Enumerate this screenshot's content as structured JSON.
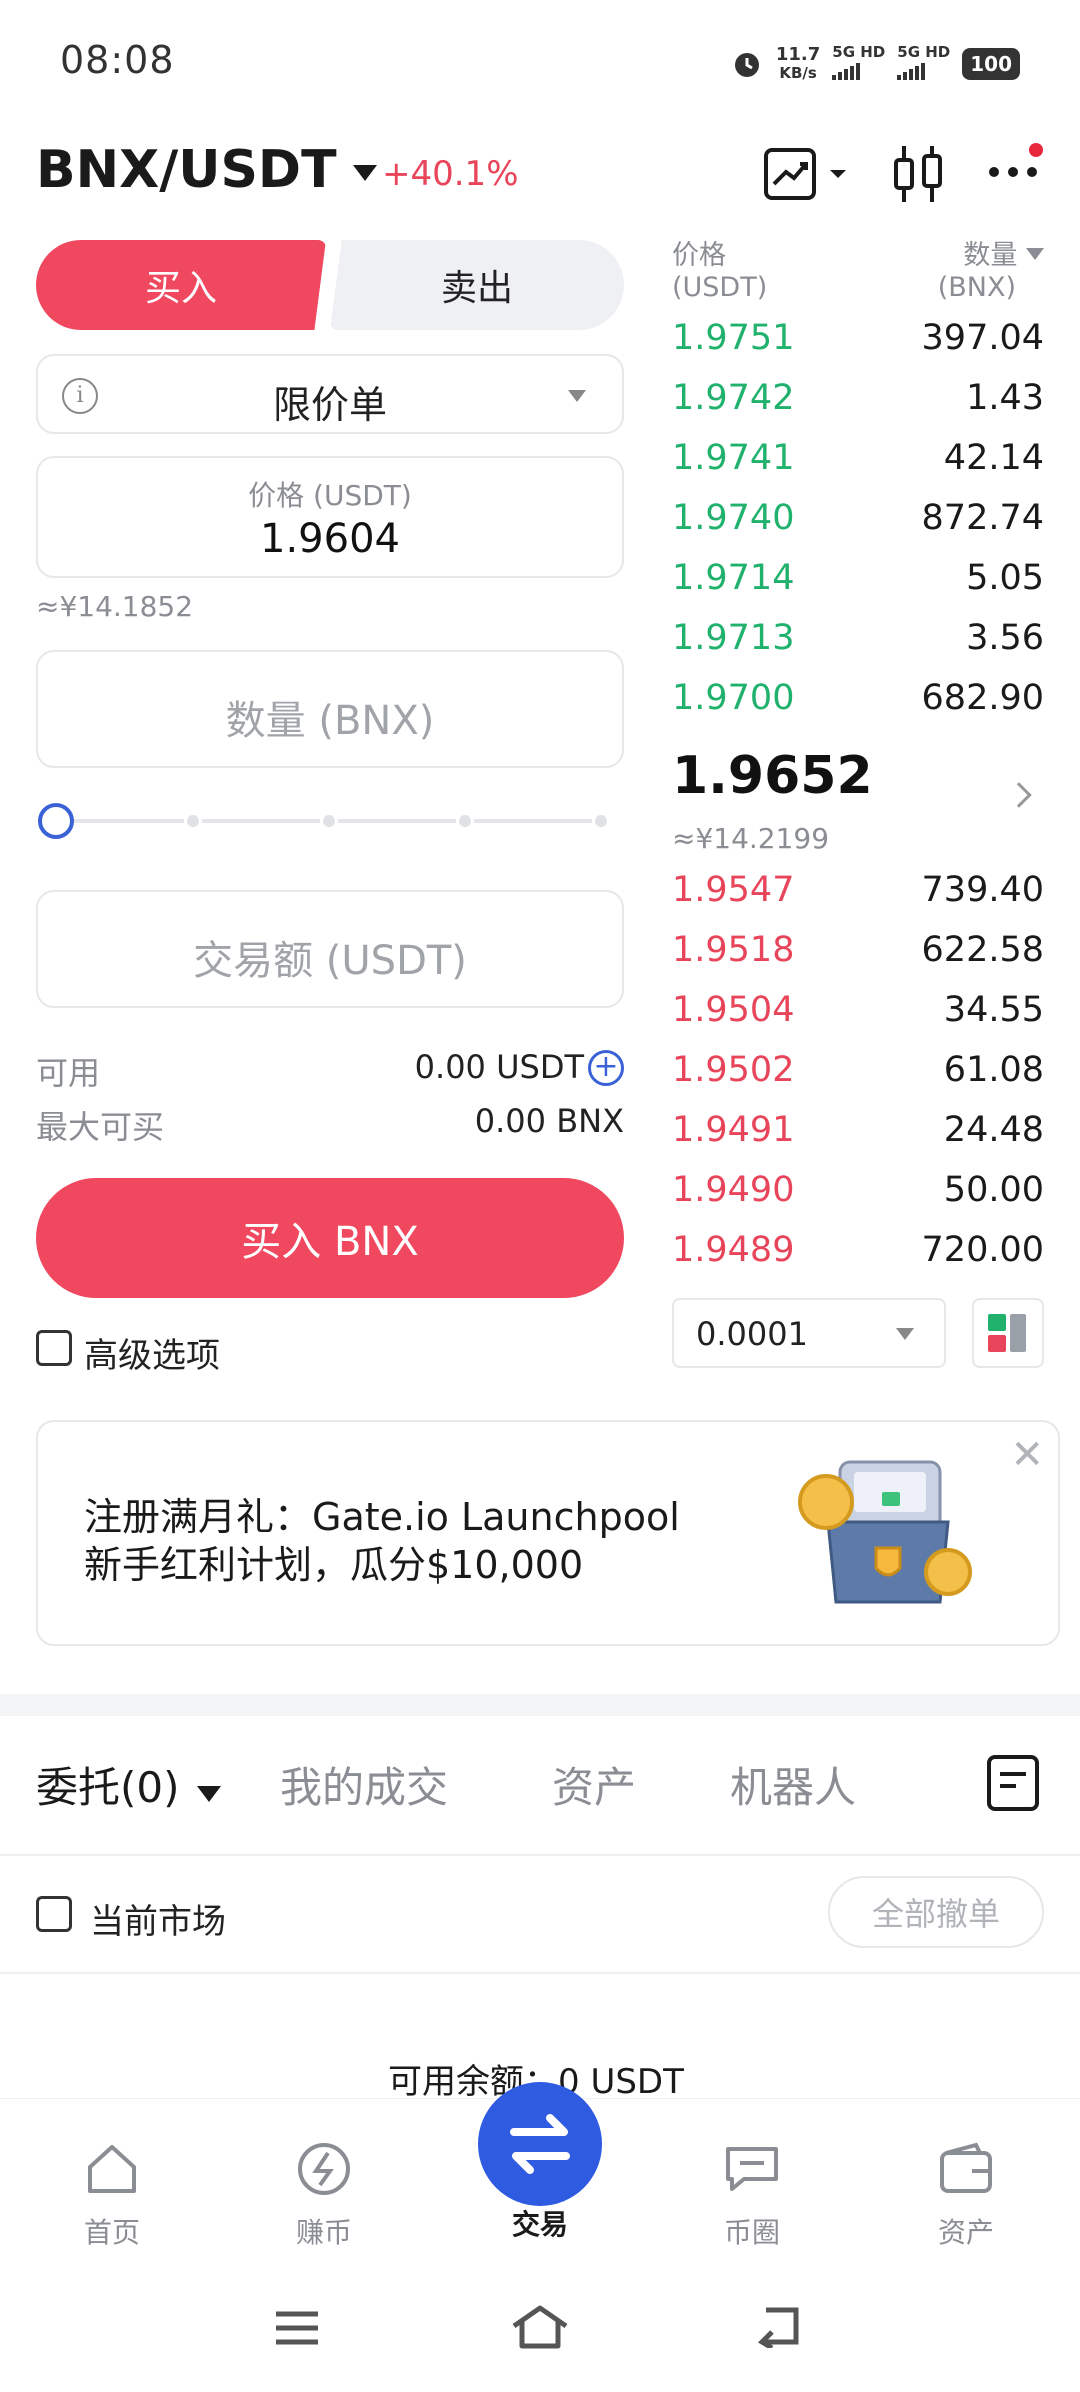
{
  "status_bar": {
    "time": "08:08",
    "speed_value": "11.7",
    "speed_unit": "KB/s",
    "net1": "5G HD",
    "net2": "5G HD",
    "battery": "100"
  },
  "header": {
    "pair": "BNX/USDT",
    "change": "+40.1%",
    "icons": [
      "chart-line-icon",
      "candlestick-icon",
      "more-icon"
    ]
  },
  "trade_form": {
    "buy_tab": "买入",
    "sell_tab": "卖出",
    "order_type": "限价单",
    "price_label": "价格 (USDT)",
    "price_value": "1.9604",
    "price_cny": "≈¥14.1852",
    "quantity_placeholder": "数量 (BNX)",
    "amount_placeholder": "交易额 (USDT)",
    "slider_percent": 0,
    "available_label": "可用",
    "available_value": "0.00 USDT",
    "max_buy_label": "最大可买",
    "max_buy_value": "0.00 BNX",
    "buy_button": "买入 BNX",
    "advanced_options": "高级选项"
  },
  "order_book": {
    "price_header": "价格",
    "price_unit": "(USDT)",
    "qty_header": "数量",
    "qty_unit": "(BNX)",
    "top_side": [
      {
        "price": "1.9751",
        "qty": "397.04"
      },
      {
        "price": "1.9742",
        "qty": "1.43"
      },
      {
        "price": "1.9741",
        "qty": "42.14"
      },
      {
        "price": "1.9740",
        "qty": "872.74"
      },
      {
        "price": "1.9714",
        "qty": "5.05"
      },
      {
        "price": "1.9713",
        "qty": "3.56"
      },
      {
        "price": "1.9700",
        "qty": "682.90"
      }
    ],
    "last_price": "1.9652",
    "last_price_cny": "≈¥14.2199",
    "bottom_side": [
      {
        "price": "1.9547",
        "qty": "739.40"
      },
      {
        "price": "1.9518",
        "qty": "622.58"
      },
      {
        "price": "1.9504",
        "qty": "34.55"
      },
      {
        "price": "1.9502",
        "qty": "61.08"
      },
      {
        "price": "1.9491",
        "qty": "24.48"
      },
      {
        "price": "1.9490",
        "qty": "50.00"
      },
      {
        "price": "1.9489",
        "qty": "720.00"
      }
    ],
    "precision": "0.0001"
  },
  "banner": {
    "line1": "注册满月礼：Gate.io Launchpool",
    "line2": "新手红利计划，瓜分$10,000"
  },
  "orders_section": {
    "tabs": [
      "委托(0)",
      "我的成交",
      "资产",
      "机器人"
    ],
    "current_market": "当前市场",
    "cancel_all": "全部撤单",
    "available_balance": "可用余额：0 USDT"
  },
  "bottom_nav": {
    "items": [
      "首页",
      "赚币",
      "交易",
      "币圈",
      "资产"
    ]
  },
  "colors": {
    "buy_red": "#f0485f",
    "ask_green": "#20b26c",
    "bid_red": "#e8455b",
    "accent_blue": "#2e5be0"
  }
}
